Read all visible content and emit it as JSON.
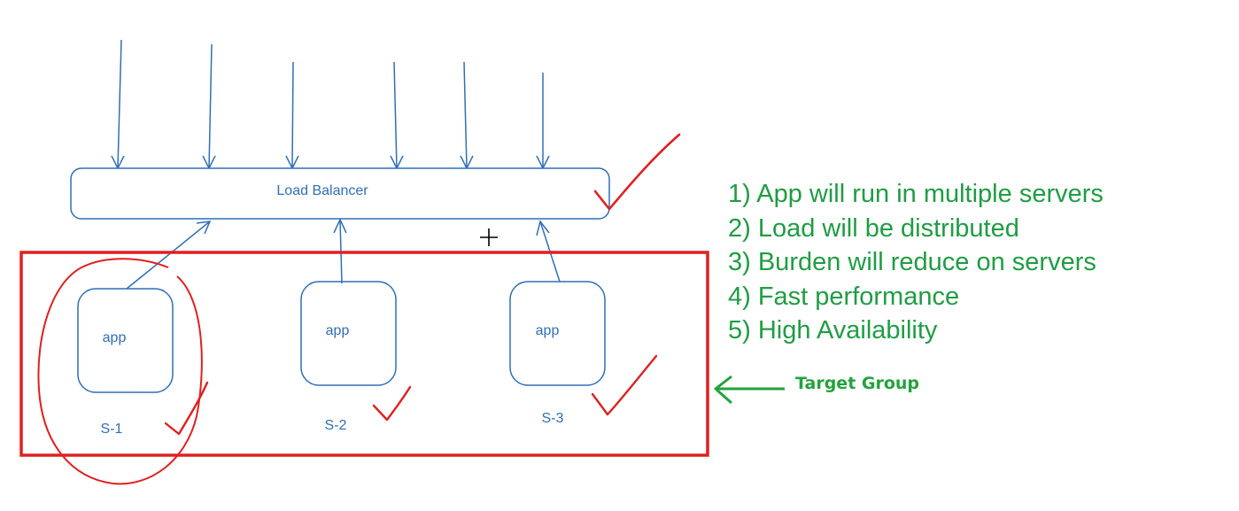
{
  "diagram": {
    "load_balancer": {
      "label": "Load Balancer"
    },
    "servers": [
      {
        "app_label": "app",
        "name": "S-1"
      },
      {
        "app_label": "app",
        "name": "S-2"
      },
      {
        "app_label": "app",
        "name": "S-3"
      }
    ],
    "target_group": {
      "label": "Target Group"
    },
    "benefits": [
      "1) App will run in multiple servers",
      "2) Load will be distributed",
      "3) Burden will reduce on servers",
      "4) Fast performance",
      "5) High Availability"
    ],
    "colors": {
      "diagram_stroke": "#2f6fb8",
      "annotation_red": "#e02020",
      "annotation_green": "#22a33c"
    }
  }
}
